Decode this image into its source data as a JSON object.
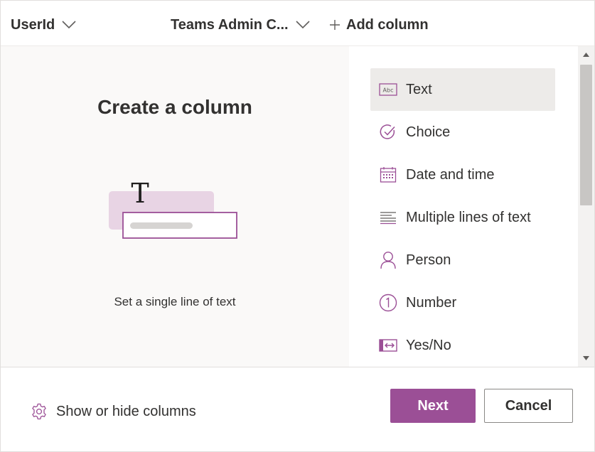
{
  "header": {
    "columns": [
      {
        "label": "UserId",
        "icon": "chevron-down-icon"
      },
      {
        "label": "Teams Admin C...",
        "icon": "chevron-down-icon"
      }
    ],
    "add_column": {
      "label": "Add column",
      "icon": "plus-icon"
    }
  },
  "preview": {
    "title": "Create a column",
    "caption": "Set a single line of text",
    "illustration_glyph": "T"
  },
  "column_types": {
    "selected_index": 0,
    "items": [
      {
        "label": "Text",
        "icon": "text-abc-icon"
      },
      {
        "label": "Choice",
        "icon": "choice-check-circle-icon"
      },
      {
        "label": "Date and time",
        "icon": "calendar-icon"
      },
      {
        "label": "Multiple lines of text",
        "icon": "multiline-text-icon"
      },
      {
        "label": "Person",
        "icon": "person-icon"
      },
      {
        "label": "Number",
        "icon": "number-circle-icon"
      },
      {
        "label": "Yes/No",
        "icon": "yes-no-toggle-icon"
      }
    ]
  },
  "footer": {
    "show_hide_label": "Show or hide columns",
    "next_label": "Next",
    "cancel_label": "Cancel"
  },
  "colors": {
    "accent": "#9b4f96",
    "selected_bg": "#edebe9",
    "preview_bg": "#faf9f8",
    "text": "#323130"
  }
}
